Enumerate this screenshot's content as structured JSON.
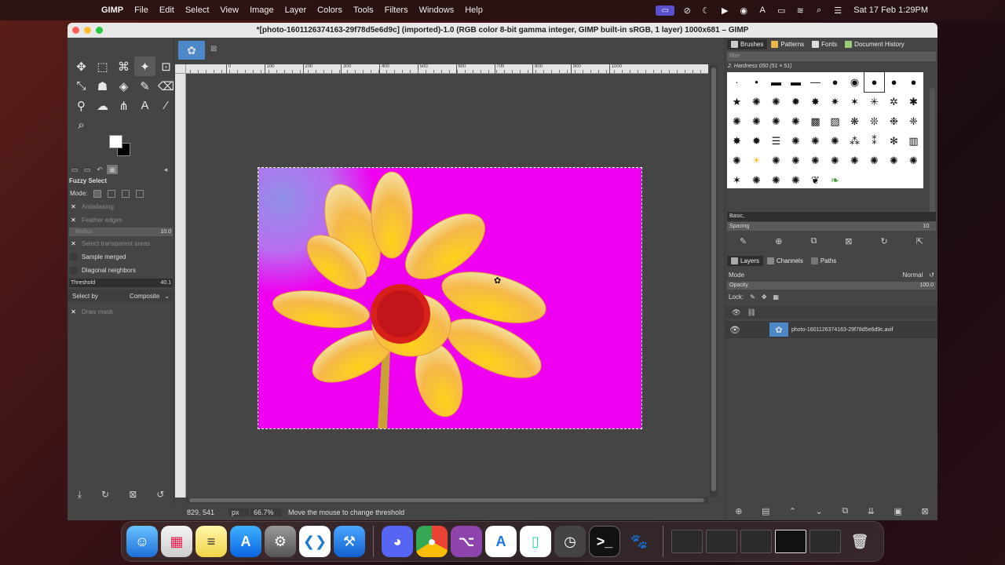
{
  "menubar": {
    "app": "GIMP",
    "items": [
      "File",
      "Edit",
      "Select",
      "View",
      "Image",
      "Layer",
      "Colors",
      "Tools",
      "Filters",
      "Windows",
      "Help"
    ],
    "clock": "Sat 17 Feb  1:29PM",
    "status_icons": [
      "screen-share-icon",
      "vpn-icon",
      "focus-moon-icon",
      "play-icon",
      "user-icon",
      "text-input-A-icon",
      "battery-icon",
      "wifi-icon",
      "search-icon",
      "control-center-icon"
    ]
  },
  "window": {
    "title": "*[photo-1601126374163-29f78d5e6d9c] (imported)-1.0 (RGB color 8-bit gamma integer, GIMP built-in sRGB, 1 layer) 1000x681 – GIMP"
  },
  "tool_options": {
    "title": "Fuzzy Select",
    "mode_label": "Mode:",
    "antialiasing": "Antialiasing",
    "feather_edges": "Feather edges",
    "radius_label": "Radius",
    "radius_value": "10.0",
    "select_transparent": "Select transparent areas",
    "sample_merged": "Sample merged",
    "diagonal_neighbors": "Diagonal neighbors",
    "threshold_label": "Threshold",
    "threshold_value": "40.1",
    "select_by_label": "Select by",
    "select_by_value": "Composite",
    "draw_mask": "Draw mask"
  },
  "ruler": {
    "h_ticks": [
      "0",
      "100",
      "200",
      "300",
      "400",
      "500",
      "600",
      "700",
      "800",
      "900",
      "1000"
    ]
  },
  "statusbar": {
    "coords": "829, 541",
    "unit": "px",
    "zoom": "66.7%",
    "message": "Move the mouse to change threshold"
  },
  "brushes_dock": {
    "tabs": [
      "Brushes",
      "Patterns",
      "Fonts",
      "Document History"
    ],
    "filter_placeholder": "filter",
    "brush_name": "2. Hardness 050 (51 × 51)",
    "preset": "Basic,",
    "spacing_label": "Spacing",
    "spacing_value": "10.0"
  },
  "layers_dock": {
    "tabs": [
      "Layers",
      "Channels",
      "Paths"
    ],
    "mode_label": "Mode",
    "mode_value": "Normal",
    "opacity_label": "Opacity",
    "opacity_value": "100.0",
    "lock_label": "Lock:",
    "layer_name": "photo-1601126374163-29f78d5e6d9c.avif"
  },
  "colors": {
    "canvas_bg": "#f000f0",
    "accent": "#4d89c9"
  },
  "dock_apps": [
    "Finder",
    "Launchpad",
    "Notes",
    "App Store",
    "System Settings",
    "VS Code",
    "Xcode",
    "Discord",
    "Chrome",
    "GitHub Desktop",
    "Apple Configurator",
    "Android Studio",
    "Screen Recorder",
    "Terminal",
    "GIMP",
    "Trash"
  ]
}
